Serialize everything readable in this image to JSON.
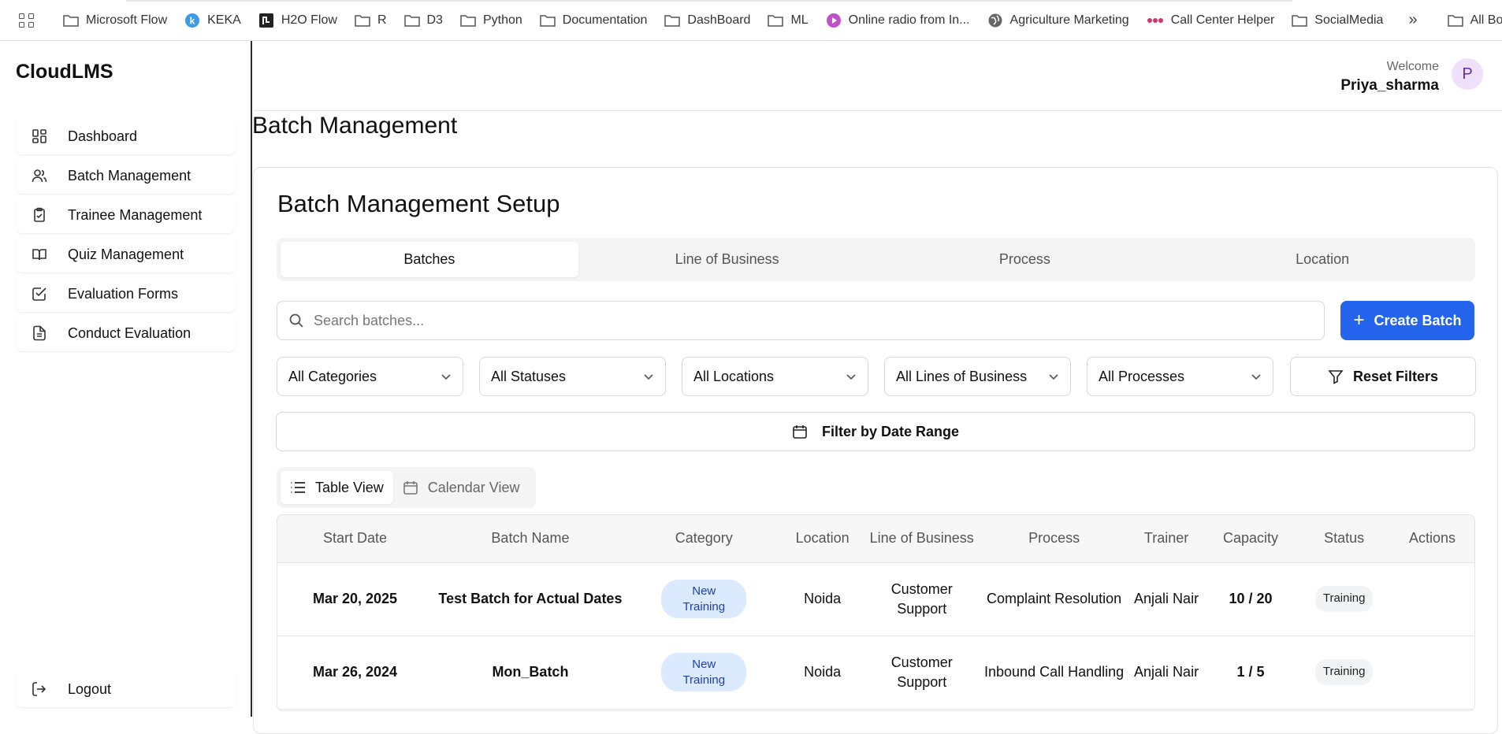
{
  "bookmarks": {
    "items": [
      {
        "label": "Microsoft Flow",
        "icon": "folder-icon"
      },
      {
        "label": "KEKA",
        "icon": "keka-icon"
      },
      {
        "label": "H2O Flow",
        "icon": "h2o-icon"
      },
      {
        "label": "R",
        "icon": "folder-icon"
      },
      {
        "label": "D3",
        "icon": "folder-icon"
      },
      {
        "label": "Python",
        "icon": "folder-icon"
      },
      {
        "label": "Documentation",
        "icon": "folder-icon"
      },
      {
        "label": "DashBoard",
        "icon": "folder-icon"
      },
      {
        "label": "ML",
        "icon": "folder-icon"
      },
      {
        "label": "Online radio from In...",
        "icon": "radio-icon"
      },
      {
        "label": "Agriculture Marketing",
        "icon": "globe-icon"
      },
      {
        "label": "Call Center Helper",
        "icon": "dots-icon"
      },
      {
        "label": "SocialMedia",
        "icon": "folder-icon"
      }
    ],
    "more": "»",
    "all_bookmarks": "All Bookmarks"
  },
  "app": {
    "name": "CloudLMS"
  },
  "sidebar": {
    "items": [
      {
        "label": "Dashboard",
        "icon": "dashboard-icon"
      },
      {
        "label": "Batch Management",
        "icon": "users-icon"
      },
      {
        "label": "Trainee Management",
        "icon": "clipboard-icon"
      },
      {
        "label": "Quiz Management",
        "icon": "book-icon"
      },
      {
        "label": "Evaluation Forms",
        "icon": "checkbox-icon"
      },
      {
        "label": "Conduct Evaluation",
        "icon": "document-icon"
      }
    ],
    "logout": "Logout"
  },
  "header": {
    "welcome": "Welcome",
    "user": "Priya_sharma",
    "avatar_initial": "P"
  },
  "page": {
    "title": "Batch Management"
  },
  "card": {
    "title": "Batch Management Setup",
    "tabs": [
      "Batches",
      "Line of Business",
      "Process",
      "Location"
    ],
    "active_tab": "Batches",
    "search_placeholder": "Search batches...",
    "create_button": "Create Batch",
    "filters": [
      "All Categories",
      "All Statuses",
      "All Locations",
      "All Lines of Business",
      "All Processes"
    ],
    "reset_filters": "Reset Filters",
    "date_range": "Filter by Date Range",
    "views": [
      "Table View",
      "Calendar View"
    ]
  },
  "table": {
    "headers": [
      "Start Date",
      "Batch Name",
      "Category",
      "Location",
      "Line of Business",
      "Process",
      "Trainer",
      "Capacity",
      "Status",
      "Actions"
    ],
    "rows": [
      {
        "start_date": "Mar 20, 2025",
        "batch_name": "Test Batch for Actual Dates",
        "category": "New Training",
        "location": "Noida",
        "lob": "Customer Support",
        "process": "Complaint Resolution",
        "trainer": "Anjali Nair",
        "capacity": "10 / 20",
        "status": "Training",
        "actions": ""
      },
      {
        "start_date": "Mar 26, 2024",
        "batch_name": "Mon_Batch",
        "category": "New Training",
        "location": "Noida",
        "lob": "Customer Support",
        "process": "Inbound Call Handling",
        "trainer": "Anjali Nair",
        "capacity": "1 / 5",
        "status": "Training",
        "actions": ""
      }
    ]
  },
  "colors": {
    "primary": "#2463eb",
    "avatar_bg": "#efe0fb",
    "avatar_fg": "#6d28a8",
    "category_badge_bg": "#dbeafe",
    "category_badge_fg": "#1e40af"
  }
}
